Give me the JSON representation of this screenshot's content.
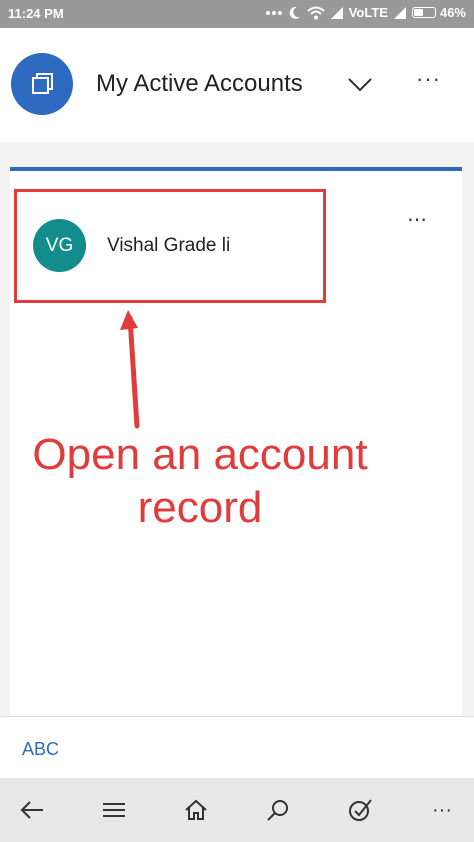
{
  "status_bar": {
    "time": "11:24 PM",
    "network": "VoLTE",
    "battery": "46%",
    "battery_level": 0.46
  },
  "header": {
    "title": "My Active Accounts",
    "app_icon": "records-icon",
    "dropdown_icon": "chevron-down-icon",
    "more_icon": "more-icon",
    "more_label": "···"
  },
  "records": [
    {
      "initials": "VG",
      "name": "Vishal Grade li",
      "more_label": "⋯"
    }
  ],
  "annotation": {
    "line1": "Open an account",
    "line2": "record"
  },
  "alpha_nav": {
    "label": "ABC"
  },
  "bottom_nav": {
    "items": [
      "back-arrow-icon",
      "menu-icon",
      "home-icon",
      "search-icon",
      "activity-icon",
      "more-icon"
    ],
    "more_label": "···"
  },
  "colors": {
    "accent": "#2e6bc0",
    "avatar": "#128c8c",
    "annotation": "#e03c3c"
  }
}
